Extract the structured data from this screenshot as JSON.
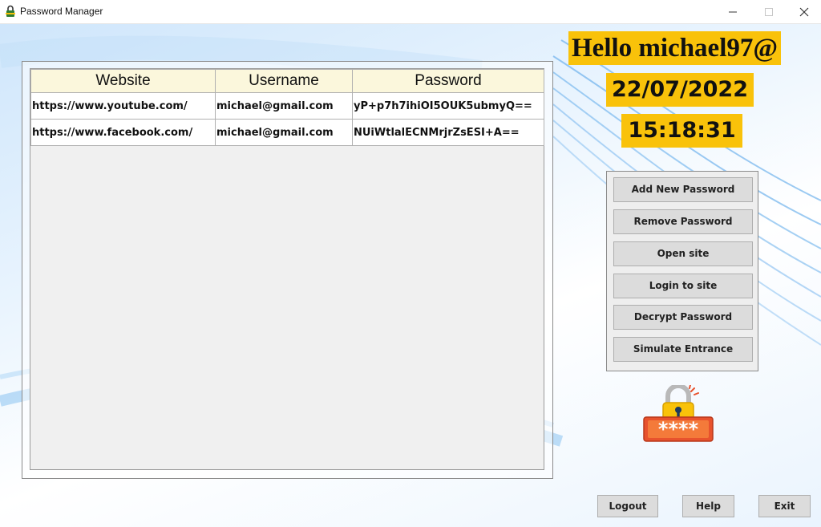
{
  "window": {
    "title": "Password Manager",
    "controls": [
      "minimize-icon",
      "maximize-icon",
      "close-icon"
    ]
  },
  "table": {
    "headers": [
      "Website",
      "Username",
      "Password"
    ],
    "rows": [
      [
        "https://www.youtube.com/",
        "michael@gmail.com",
        "yP+p7h7ihiOI5OUK5ubmyQ=="
      ],
      [
        "https://www.facebook.com/",
        "michael@gmail.com",
        "NUiWtlalECNMrjrZsESI+A=="
      ]
    ]
  },
  "header_info": {
    "greeting": "Hello  michael97@",
    "date": "22/07/2022",
    "time": "15:18:31"
  },
  "actions": {
    "add": "Add New Password",
    "remove": "Remove Password",
    "open": "Open site",
    "login": "Login to site",
    "decrypt": "Decrypt Password",
    "simulate": "Simulate Entrance"
  },
  "footer": {
    "logout": "Logout",
    "help": "Help",
    "exit": "Exit"
  },
  "decor": {
    "lock_icon": "padlock-password-icon",
    "lock_mask": "****"
  },
  "colors": {
    "highlight": "#f9c20a",
    "header_bg": "#fbf7dc",
    "button_bg": "#dcdcdc",
    "lock_red": "#e8522d"
  }
}
